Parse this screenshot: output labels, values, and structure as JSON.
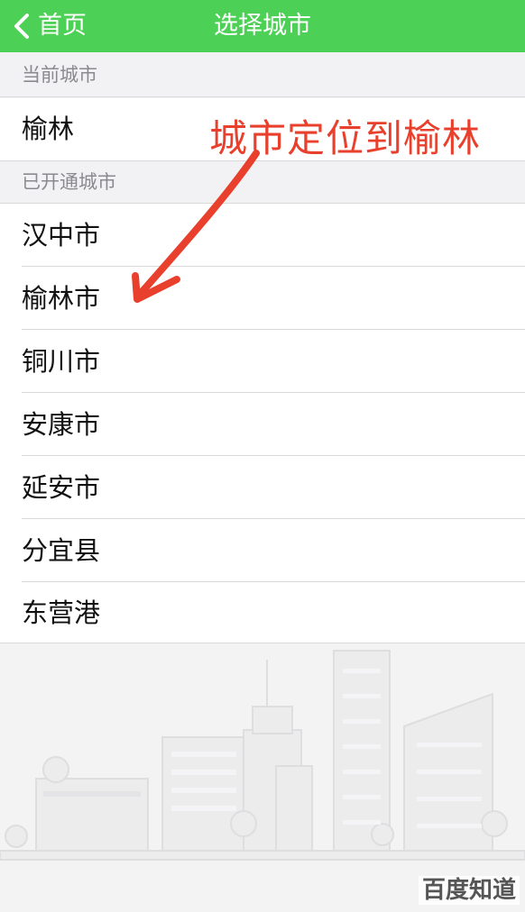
{
  "navbar": {
    "back_label": "首页",
    "title": "选择城市",
    "background": "#4cd055"
  },
  "current_section": {
    "header": "当前城市",
    "city": "榆林"
  },
  "open_section": {
    "header": "已开通城市",
    "cities": [
      "汉中市",
      "榆林市",
      "铜川市",
      "安康市",
      "延安市",
      "分宜县",
      "东营港"
    ]
  },
  "annotation": {
    "text": "城市定位到榆林",
    "color": "#e8402c"
  },
  "watermark": {
    "text": "百度知道"
  },
  "icons": {
    "back": "chevron-left-icon",
    "illustration": "city-skyline-illustration"
  }
}
